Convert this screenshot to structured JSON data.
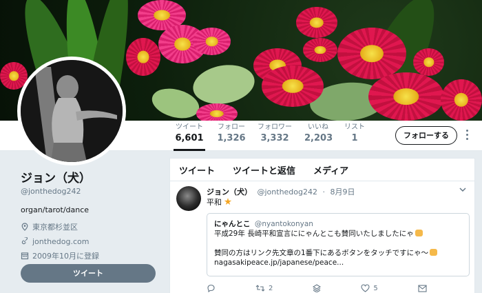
{
  "banner": {
    "description_icon": "flower-photo"
  },
  "stats": [
    {
      "label": "ツイート",
      "value": "6,601",
      "active": true
    },
    {
      "label": "フォロー",
      "value": "1,326",
      "active": false
    },
    {
      "label": "フォロワー",
      "value": "3,332",
      "active": false
    },
    {
      "label": "いいね",
      "value": "2,203",
      "active": false
    },
    {
      "label": "リスト",
      "value": "1",
      "active": false
    }
  ],
  "follow_button": "フォローする",
  "profile": {
    "name": "ジョン（犬）",
    "handle": "@jonthedog242",
    "bio": "organ/tarot/dance",
    "location": "東京都杉並区",
    "website": "jonthedog.com",
    "joined": "2009年10月に登録",
    "tweet_button": "ツイート"
  },
  "tabs": [
    "ツイート",
    "ツイートと返信",
    "メディア"
  ],
  "tweet": {
    "name": "ジョン（犬）",
    "handle": "@jonthedog242",
    "date": "8月9日",
    "text": "平和",
    "quote": {
      "name": "にゃんとこ",
      "handle": "@nyantokonyan",
      "line1": "平成29年 長崎平和宣言ににゃんとこも賛同いたしましたにゃ",
      "line2": "賛同の方はリンク先文章の1番下にあるボタンをタッチですにゃ～",
      "link": "nagasakipeace.jp/japanese/peace..."
    },
    "retweets": "2",
    "likes": "5"
  },
  "colors": {
    "accent": "#14171a",
    "muted": "#657786",
    "background": "#e6ecf0"
  }
}
